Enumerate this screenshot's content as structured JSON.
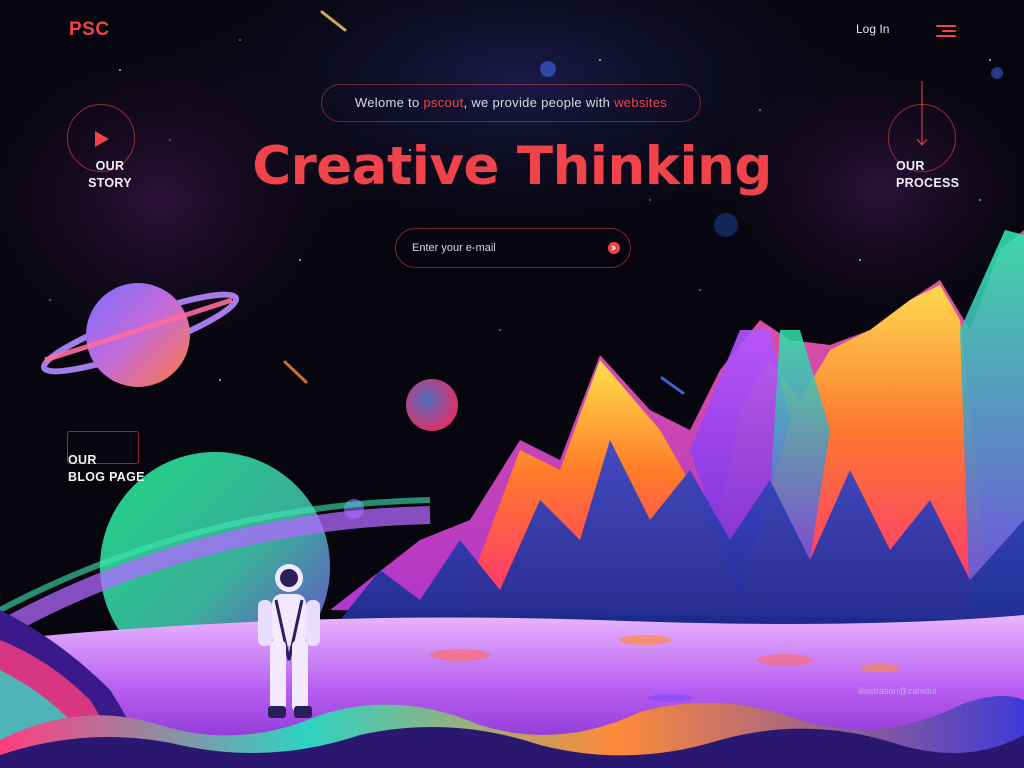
{
  "brand": {
    "logo": "PSC"
  },
  "header": {
    "login_label": "Log In",
    "menu_icon": "hamburger-menu-icon"
  },
  "hero": {
    "welcome_prefix": "Welome to ",
    "welcome_brand": "pscout",
    "welcome_middle": ", we provide people with ",
    "welcome_highlight": "websites",
    "headline": "Creative Thinking"
  },
  "subscribe": {
    "placeholder": "Enter your e-mail",
    "submit_icon": "arrow-right-icon"
  },
  "side_nav": {
    "our_story": {
      "line1": "OUR",
      "line2": "STORY",
      "icon": "play-icon"
    },
    "our_process": {
      "line1": "OUR",
      "line2": "PROCESS",
      "icon": "arrow-down-icon"
    },
    "blog": {
      "line1": "OUR",
      "line2": "BLOG PAGE"
    }
  },
  "credit": "illustration@zahidul",
  "colors": {
    "accent": "#f0444a",
    "background": "#07060f",
    "text": "#f2f2f6"
  }
}
